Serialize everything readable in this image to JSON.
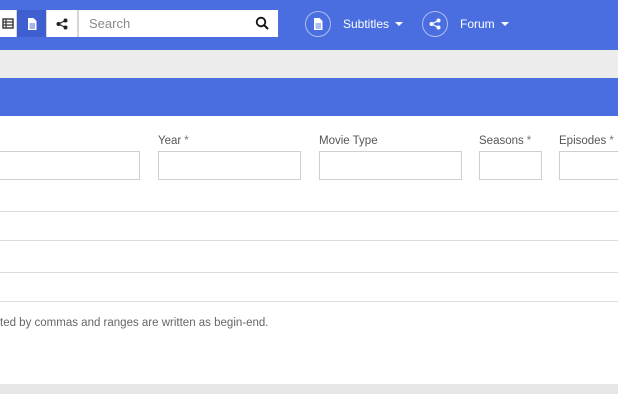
{
  "navbar": {
    "search": {
      "placeholder": "Search"
    },
    "items": [
      {
        "label": "Subtitles",
        "icon": "document-icon"
      },
      {
        "label": "Forum",
        "icon": "share-icon"
      }
    ],
    "accent": "#4a6ee0"
  },
  "form": {
    "fields": [
      {
        "label": "Year",
        "required_mark": "*",
        "value": ""
      },
      {
        "label": "Movie Type",
        "required_mark": "",
        "value": ""
      },
      {
        "label": "Seasons",
        "required_mark": "*",
        "value": ""
      },
      {
        "label": "Episodes",
        "required_mark": "*",
        "value": ""
      }
    ],
    "help_text": "ted by commas and ranges are written as begin-end."
  }
}
